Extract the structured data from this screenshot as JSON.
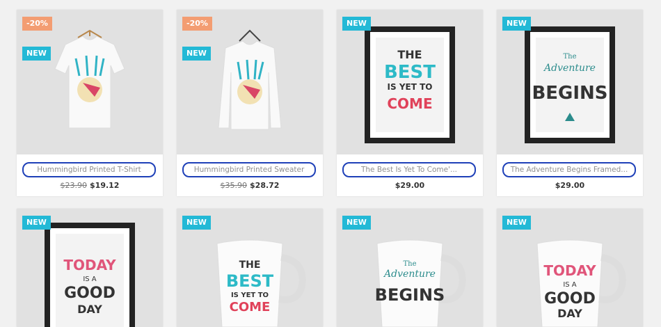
{
  "products": [
    {
      "name": "Hummingbird Printed T-Shirt",
      "old_price": "$23.90",
      "price": "$19.12",
      "discount": "-20%",
      "badge": "NEW"
    },
    {
      "name": "Hummingbird Printed Sweater",
      "old_price": "$35.90",
      "price": "$28.72",
      "discount": "-20%",
      "badge": "NEW"
    },
    {
      "name": "The Best Is Yet To Come'...",
      "price": "$29.00",
      "badge": "NEW"
    },
    {
      "name": "The Adventure Begins Framed...",
      "price": "$29.00",
      "badge": "NEW"
    },
    {
      "badge": "NEW"
    },
    {
      "badge": "NEW"
    },
    {
      "badge": "NEW"
    },
    {
      "badge": "NEW"
    }
  ],
  "poster_text": {
    "best": [
      "THE",
      "BEST",
      "IS YET TO",
      "COME"
    ],
    "adventure": [
      "The",
      "Adventure",
      "BEGINS"
    ],
    "today": [
      "TODAY",
      "IS A",
      "GOOD",
      "DAY"
    ]
  },
  "colors": {
    "new_badge": "#23b9d6",
    "discount_badge": "#f39d72",
    "highlight_border": "#1e40b8"
  }
}
